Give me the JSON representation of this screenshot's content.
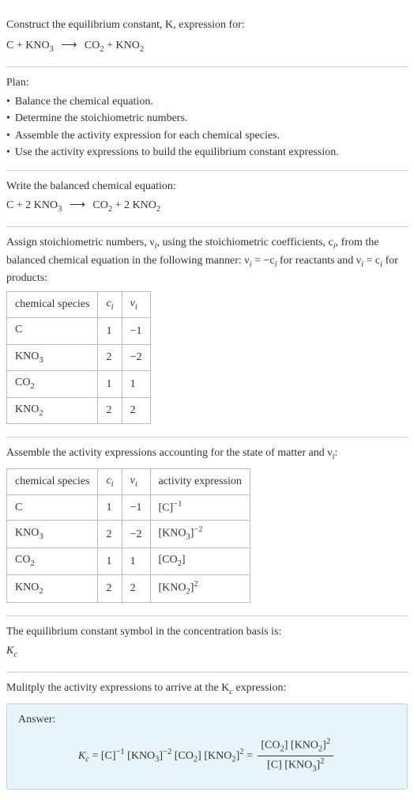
{
  "intro": {
    "line1": "Construct the equilibrium constant, K, expression for:",
    "equation_lhs": "C + KNO",
    "equation_sub1": "3",
    "equation_rhs1": "CO",
    "equation_sub2": "2",
    "equation_rhs2": " + KNO",
    "equation_sub3": "2"
  },
  "plan": {
    "title": "Plan:",
    "items": [
      "Balance the chemical equation.",
      "Determine the stoichiometric numbers.",
      "Assemble the activity expression for each chemical species.",
      "Use the activity expressions to build the equilibrium constant expression."
    ]
  },
  "balanced": {
    "title": "Write the balanced chemical equation:",
    "lhs1": "C + 2 KNO",
    "sub1": "3",
    "rhs1": "CO",
    "sub2": "2",
    "rhs2": " + 2 KNO",
    "sub3": "2"
  },
  "stoich": {
    "text1": "Assign stoichiometric numbers, ν",
    "text1sub": "i",
    "text2": ", using the stoichiometric coefficients, c",
    "text2sub": "i",
    "text3": ", from the balanced chemical equation in the following manner: ν",
    "text3sub": "i",
    "text4": " = −c",
    "text4sub": "i",
    "text5": " for reactants and ν",
    "text5sub": "i",
    "text6": " = c",
    "text6sub": "i",
    "text7": " for products:",
    "headers": {
      "species": "chemical species",
      "c": "c",
      "csub": "i",
      "nu": "ν",
      "nusub": "i"
    },
    "rows": [
      {
        "species": "C",
        "sub": "",
        "c": "1",
        "nu": "−1"
      },
      {
        "species": "KNO",
        "sub": "3",
        "c": "2",
        "nu": "−2"
      },
      {
        "species": "CO",
        "sub": "2",
        "c": "1",
        "nu": "1"
      },
      {
        "species": "KNO",
        "sub": "2",
        "c": "2",
        "nu": "2"
      }
    ]
  },
  "activity": {
    "title1": "Assemble the activity expressions accounting for the state of matter and ν",
    "title1sub": "i",
    "title2": ":",
    "headers": {
      "species": "chemical species",
      "c": "c",
      "csub": "i",
      "nu": "ν",
      "nusub": "i",
      "expr": "activity expression"
    },
    "rows": [
      {
        "species": "C",
        "sub": "",
        "c": "1",
        "nu": "−1",
        "base": "[C]",
        "basesub": "",
        "exp": "−1"
      },
      {
        "species": "KNO",
        "sub": "3",
        "c": "2",
        "nu": "−2",
        "base": "[KNO",
        "basesub": "3",
        "baseend": "]",
        "exp": "−2"
      },
      {
        "species": "CO",
        "sub": "2",
        "c": "1",
        "nu": "1",
        "base": "[CO",
        "basesub": "2",
        "baseend": "]",
        "exp": ""
      },
      {
        "species": "KNO",
        "sub": "2",
        "c": "2",
        "nu": "2",
        "base": "[KNO",
        "basesub": "2",
        "baseend": "]",
        "exp": "2"
      }
    ]
  },
  "symbol": {
    "text": "The equilibrium constant symbol in the concentration basis is:",
    "sym": "K",
    "symsub": "c"
  },
  "final": {
    "text": "Mulitply the activity expressions to arrive at the K",
    "textsub": "c",
    "text2": " expression:",
    "answer_label": "Answer:",
    "Kc_pre": "K",
    "Kc_sub": "c",
    "eq": " = ",
    "t1": "[C]",
    "t1exp": "−1",
    "t2": " [KNO",
    "t2sub": "3",
    "t2end": "]",
    "t2exp": "−2",
    "t3": " [CO",
    "t3sub": "2",
    "t3end": "]",
    "t4": " [KNO",
    "t4sub": "2",
    "t4end": "]",
    "t4exp": "2",
    "eq2": " = ",
    "num1": "[CO",
    "num1sub": "2",
    "num1end": "] [KNO",
    "num2sub": "2",
    "num2end": "]",
    "num2exp": "2",
    "den1": "[C] [KNO",
    "den1sub": "3",
    "den1end": "]",
    "den1exp": "2"
  },
  "chart_data": {
    "type": "table",
    "tables": [
      {
        "title": "stoichiometric numbers",
        "columns": [
          "chemical species",
          "c_i",
          "ν_i"
        ],
        "rows": [
          [
            "C",
            1,
            -1
          ],
          [
            "KNO3",
            2,
            -2
          ],
          [
            "CO2",
            1,
            1
          ],
          [
            "KNO2",
            2,
            2
          ]
        ]
      },
      {
        "title": "activity expressions",
        "columns": [
          "chemical species",
          "c_i",
          "ν_i",
          "activity expression"
        ],
        "rows": [
          [
            "C",
            1,
            -1,
            "[C]^-1"
          ],
          [
            "KNO3",
            2,
            -2,
            "[KNO3]^-2"
          ],
          [
            "CO2",
            1,
            1,
            "[CO2]"
          ],
          [
            "KNO2",
            2,
            2,
            "[KNO2]^2"
          ]
        ]
      }
    ]
  }
}
